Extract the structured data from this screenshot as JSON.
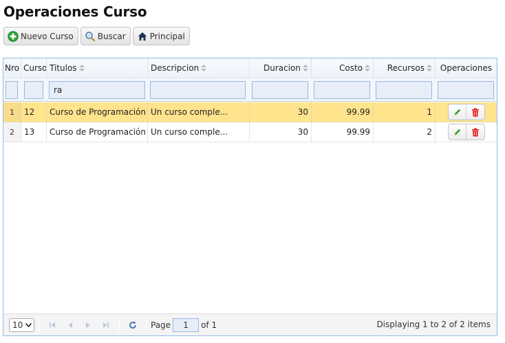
{
  "page": {
    "title": "Operaciones Curso"
  },
  "toolbar": {
    "new_label": "Nuevo Curso",
    "search_label": "Buscar",
    "home_label": "Principal"
  },
  "grid": {
    "columns": {
      "nro": "Nro",
      "curso": "Curso",
      "titulos": "Titulos",
      "descripcion": "Descripcion",
      "duracion": "Duracion",
      "costo": "Costo",
      "recursos": "Recursos",
      "operaciones": "Operaciones"
    },
    "filters": {
      "titulos": "ra"
    },
    "rows": [
      {
        "nro": "1",
        "curso": "12",
        "titulo": "Curso de Programación en Java",
        "descripcion": "Un curso comple...",
        "duracion": "30",
        "costo": "99.99",
        "recursos": "1",
        "selected": true
      },
      {
        "nro": "2",
        "curso": "13",
        "titulo": "Curso de Programación en Python",
        "descripcion": "Un curso comple...",
        "duracion": "30",
        "costo": "99.99",
        "recursos": "2",
        "selected": false
      }
    ]
  },
  "pager": {
    "page_size": "10",
    "page_label": "Page",
    "page_number": "1",
    "of_label": "of 1",
    "info": "Displaying 1 to 2 of 2 items"
  },
  "icons": {
    "new": "plus-circle-icon",
    "search": "magnifier-icon",
    "home": "home-icon",
    "edit": "pencil-icon",
    "delete": "trash-icon"
  },
  "colors": {
    "selected_row": "#ffe48d",
    "grid_border": "#95b8e7",
    "delete_red": "#e0191a",
    "edit_green": "#3aa02c"
  }
}
